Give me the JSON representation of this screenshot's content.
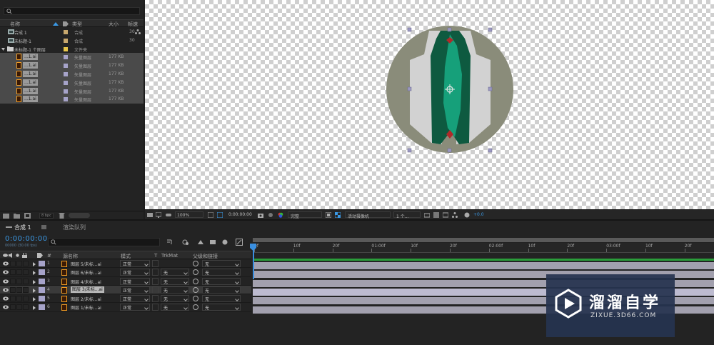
{
  "project": {
    "search_placeholder": "ρ▾",
    "columns": {
      "name": "名称",
      "type": "类型",
      "size": "大小",
      "duration": "帧速"
    },
    "items": [
      {
        "name": "合成 1",
        "type": "合成",
        "size": "",
        "duration": "30",
        "chip": "#c8a86e",
        "kind": "comp"
      },
      {
        "name": "未标题-1",
        "type": "合成",
        "size": "",
        "duration": "30",
        "chip": "#c8a86e",
        "kind": "comp"
      },
      {
        "name": "未标题-1 个图层",
        "type": "文件夹",
        "size": "",
        "duration": "",
        "chip": "#e8c64a",
        "kind": "folder"
      },
      {
        "name": "...1.ai",
        "type": "矢量图层",
        "size": "177 KB",
        "duration": "",
        "chip": "#a6a3c9",
        "kind": "ai"
      },
      {
        "name": "...1.ai",
        "type": "矢量图层",
        "size": "177 KB",
        "duration": "",
        "chip": "#a6a3c9",
        "kind": "ai"
      },
      {
        "name": "...1.ai",
        "type": "矢量图层",
        "size": "177 KB",
        "duration": "",
        "chip": "#a6a3c9",
        "kind": "ai"
      },
      {
        "name": "...1.ai",
        "type": "矢量图层",
        "size": "177 KB",
        "duration": "",
        "chip": "#a6a3c9",
        "kind": "ai"
      },
      {
        "name": "...1.ai",
        "type": "矢量图层",
        "size": "177 KB",
        "duration": "",
        "chip": "#a6a3c9",
        "kind": "ai"
      },
      {
        "name": "...1.ai",
        "type": "矢量图层",
        "size": "177 KB",
        "duration": "",
        "chip": "#a6a3c9",
        "kind": "ai"
      }
    ],
    "bpc": "8 bpc"
  },
  "viewer": {
    "zoom": "100%",
    "timecode": "0:00:00:00",
    "resolution": "完整",
    "camera": "活动摄像机",
    "views": "1 个...",
    "exposure": "+0.0"
  },
  "timeline": {
    "tabs": [
      {
        "label": "合成 1"
      },
      {
        "label": "渲染队列"
      }
    ],
    "timecode": "0:00:00:00",
    "fps": "00000 (30.00 fps)",
    "search_placeholder": "ρ▾",
    "columns": {
      "num": "#",
      "source": "源名称",
      "mode": "模式",
      "t": "T",
      "trkmat": "TrkMat",
      "parent": "父级和链接"
    },
    "layers": [
      {
        "num": "1",
        "name": "图层 5/未标...ai",
        "mode": "正常",
        "trkmat": "",
        "parent": "无"
      },
      {
        "num": "2",
        "name": "图层 6/未标...ai",
        "mode": "正常",
        "trkmat": "无",
        "parent": "无"
      },
      {
        "num": "3",
        "name": "图层 4/未标...ai",
        "mode": "正常",
        "trkmat": "无",
        "parent": "无"
      },
      {
        "num": "4",
        "name": "图层 3/未标...ai",
        "mode": "正常",
        "trkmat": "无",
        "parent": "无"
      },
      {
        "num": "5",
        "name": "图层 2/未标...ai",
        "mode": "正常",
        "trkmat": "无",
        "parent": "无"
      },
      {
        "num": "6",
        "name": "图层 1/未标...ai",
        "mode": "正常",
        "trkmat": "无",
        "parent": "无"
      }
    ],
    "ruler": [
      "0f",
      "10f",
      "20f",
      "01:00f",
      "10f",
      "20f",
      "02:00f",
      "10f",
      "20f",
      "03:00f",
      "10f",
      "20f"
    ]
  },
  "watermark": {
    "title": "溜溜自学",
    "url": "ZIXUE.3D66.COM"
  },
  "colors": {
    "accent": "#3a98e4",
    "label": "#a6a3c9",
    "workarea": "#2a9d3a"
  }
}
